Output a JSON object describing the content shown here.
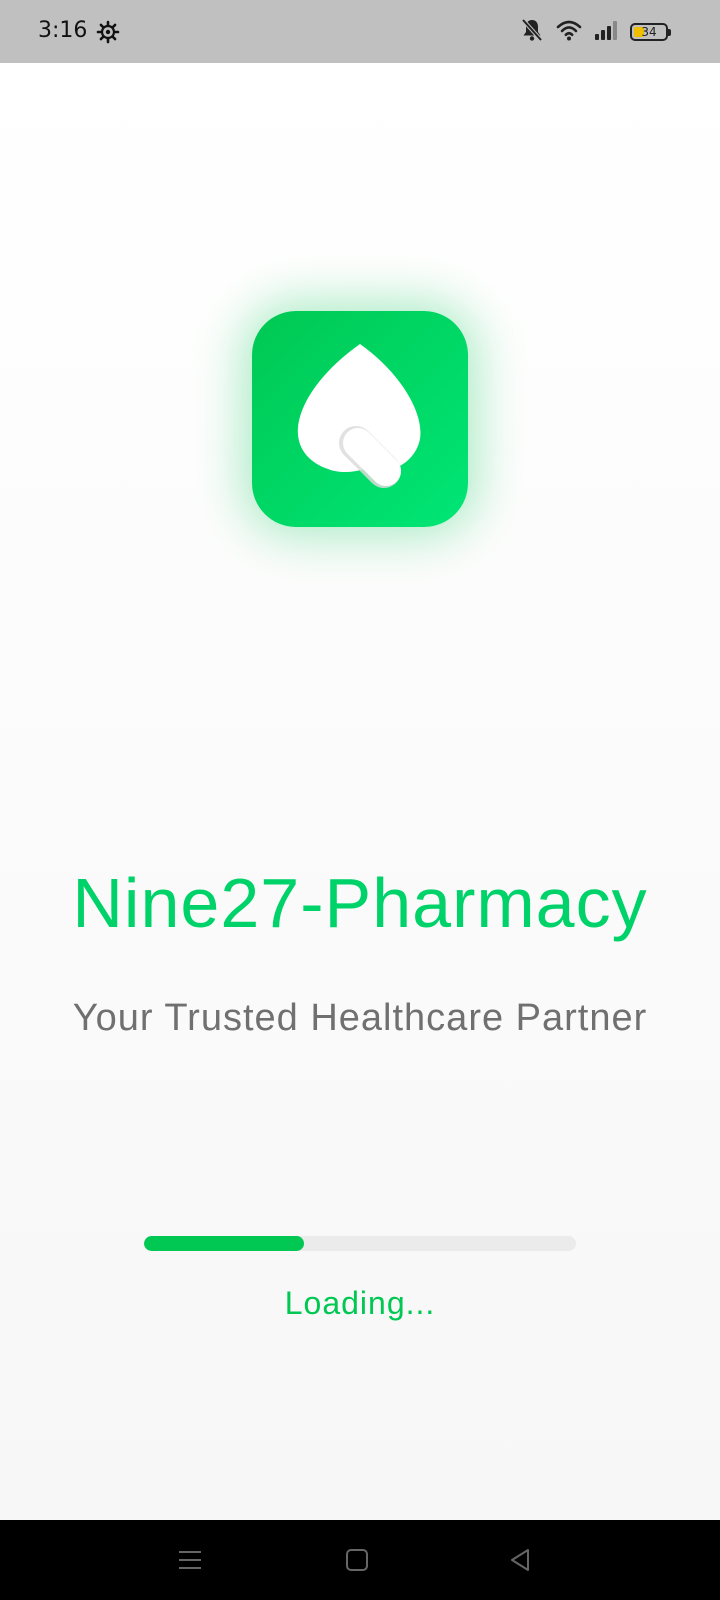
{
  "status_bar": {
    "time": "3:16",
    "battery_level": "34",
    "icons": [
      "gear-icon",
      "bell-off-icon",
      "wifi-icon",
      "signal-icon",
      "battery-icon"
    ]
  },
  "splash": {
    "logo_icon": "leaf-pill-icon",
    "title": "Nine27-Pharmacy",
    "subtitle": "Your Trusted Healthcare Partner",
    "progress_percent": 37,
    "loading_text": "Loading..."
  },
  "colors": {
    "brand_green": "#00d26a",
    "logo_gradient_start": "#00c853",
    "logo_gradient_end": "#00e676",
    "subtitle_gray": "#707070",
    "progress_track": "#ebebeb",
    "status_bar_bg": "#c0c0c0",
    "nav_bar_bg": "#000000"
  },
  "nav_bar": {
    "buttons": [
      "menu-icon",
      "home-icon",
      "back-icon"
    ]
  }
}
